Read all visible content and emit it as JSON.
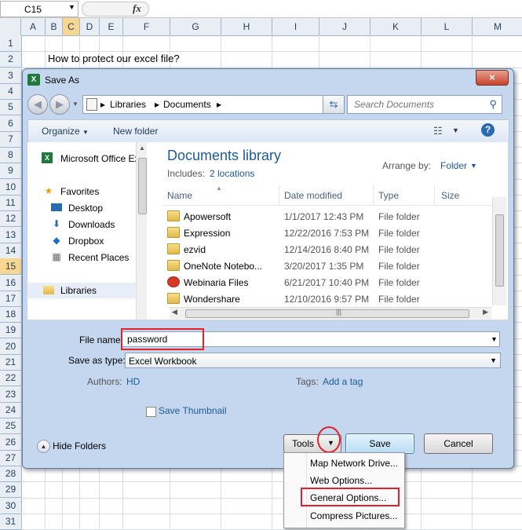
{
  "excel": {
    "name_box": "C15",
    "fx_label": "fx",
    "columns": [
      "A",
      "B",
      "C",
      "D",
      "E",
      "F",
      "G",
      "H",
      "I",
      "J",
      "K",
      "L",
      "M"
    ],
    "selected_column": "C",
    "rows": [
      "1",
      "2",
      "3",
      "4",
      "5",
      "6",
      "7",
      "8",
      "9",
      "10",
      "11",
      "12",
      "13",
      "14",
      "15",
      "16",
      "17",
      "18",
      "19",
      "20",
      "21",
      "22",
      "23",
      "24",
      "25",
      "26",
      "27",
      "28",
      "29",
      "30",
      "31"
    ],
    "selected_row": "15",
    "cell_a2": "How to protect our excel file?"
  },
  "dialog": {
    "title": "Save As",
    "close": "×",
    "breadcrumb": [
      "Libraries",
      "Documents"
    ],
    "search_placeholder": "Search Documents",
    "organize": "Organize",
    "new_folder": "New folder",
    "help": "?",
    "nav_items": [
      {
        "label": "Microsoft Office Ex",
        "icon": "excel-icon"
      },
      {
        "label": "Favorites",
        "icon": "star-icon"
      },
      {
        "label": "Desktop",
        "icon": "desktop-icon"
      },
      {
        "label": "Downloads",
        "icon": "downloads-icon"
      },
      {
        "label": "Dropbox",
        "icon": "dropbox-icon"
      },
      {
        "label": "Recent Places",
        "icon": "recent-places-icon"
      },
      {
        "label": "Libraries",
        "icon": "libraries-icon"
      }
    ],
    "library_title": "Documents library",
    "includes_label": "Includes:",
    "includes_link": "2 locations",
    "arrange_by_label": "Arrange by:",
    "arrange_by_value": "Folder",
    "columns": [
      "Name",
      "Date modified",
      "Type",
      "Size"
    ],
    "files": [
      {
        "name": "Apowersoft",
        "date": "1/1/2017 12:43 PM",
        "type": "File folder"
      },
      {
        "name": "Expression",
        "date": "12/22/2016 7:53 PM",
        "type": "File folder"
      },
      {
        "name": "ezvid",
        "date": "12/14/2016 8:40 PM",
        "type": "File folder"
      },
      {
        "name": "OneNote Notebo...",
        "date": "3/20/2017 1:35 PM",
        "type": "File folder"
      },
      {
        "name": "Webinaria Files",
        "date": "6/21/2017 10:40 PM",
        "type": "File folder"
      },
      {
        "name": "Wondershare",
        "date": "12/10/2016 9:57 PM",
        "type": "File folder"
      }
    ],
    "file_name_label": "File name:",
    "file_name_value": "password",
    "save_type_label": "Save as type:",
    "save_type_value": "Excel Workbook",
    "authors_label": "Authors:",
    "authors_value": "HD",
    "tags_label": "Tags:",
    "tags_value": "Add a tag",
    "save_thumbnail": "Save Thumbnail",
    "hide_folders": "Hide Folders",
    "tools": "Tools",
    "save": "Save",
    "cancel": "Cancel"
  },
  "tools_menu": {
    "items": [
      "Map Network Drive...",
      "Web Options...",
      "General Options...",
      "Compress Pictures..."
    ]
  },
  "colors": {
    "accent_red": "#e2202a",
    "link_blue": "#1e5a96",
    "excel_green": "#1e7a3c"
  }
}
